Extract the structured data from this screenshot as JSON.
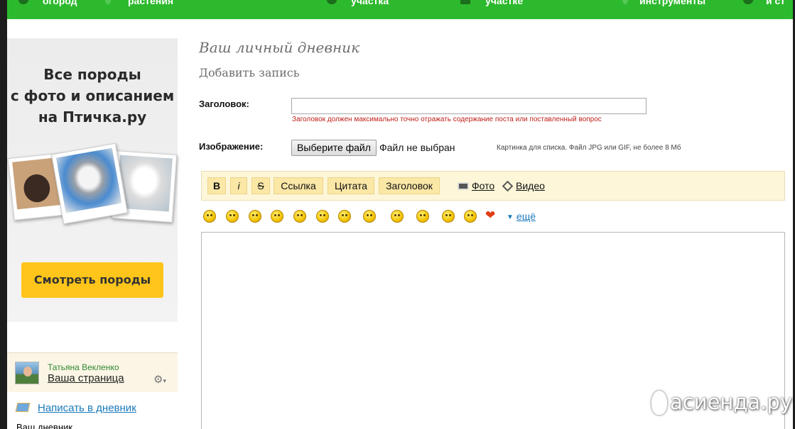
{
  "top_nav": {
    "items": [
      "огород",
      "растения",
      "участка",
      "участке",
      "инструменты",
      "и ст"
    ]
  },
  "ad": {
    "line1": "Все породы",
    "line2": "с фото и описанием",
    "line3": "на Птичка.ру",
    "button": "Смотреть породы"
  },
  "user": {
    "name": "Татьяна Векленко",
    "page_link": "Ваша страница"
  },
  "sidebar": {
    "write_link": "Написать в дневник",
    "diary_link": "Ваш дневник"
  },
  "page": {
    "title": "Ваш личный дневник",
    "subtitle": "Добавить запись"
  },
  "form": {
    "title_label": "Заголовок:",
    "title_value": "",
    "title_hint": "Заголовок должен максимально точно отражать содержание поста или поставленный вопрос",
    "image_label": "Изображение:",
    "file_button": "Выберите файл",
    "file_status": "Файл не выбран",
    "file_hint": "Картинка для списка. Файл JPG или GIF, не более 8 Мб"
  },
  "toolbar": {
    "bold": "B",
    "italic": "i",
    "strike": "S",
    "link": "Ссылка",
    "quote": "Цитата",
    "heading": "Заголовок",
    "photo": "Фото",
    "video": "Видео"
  },
  "smileys": {
    "more": "ещё",
    "heart_color": "#e23b12"
  },
  "editor": {
    "value": ""
  },
  "watermark": {
    "text": "асиенда.ру"
  },
  "colors": {
    "nav_green": "#2db92d",
    "ad_button": "#ffc51a",
    "toolbar_bg": "#fdf6d8",
    "hint_red": "#c0201a",
    "link_blue": "#1a7abb"
  }
}
